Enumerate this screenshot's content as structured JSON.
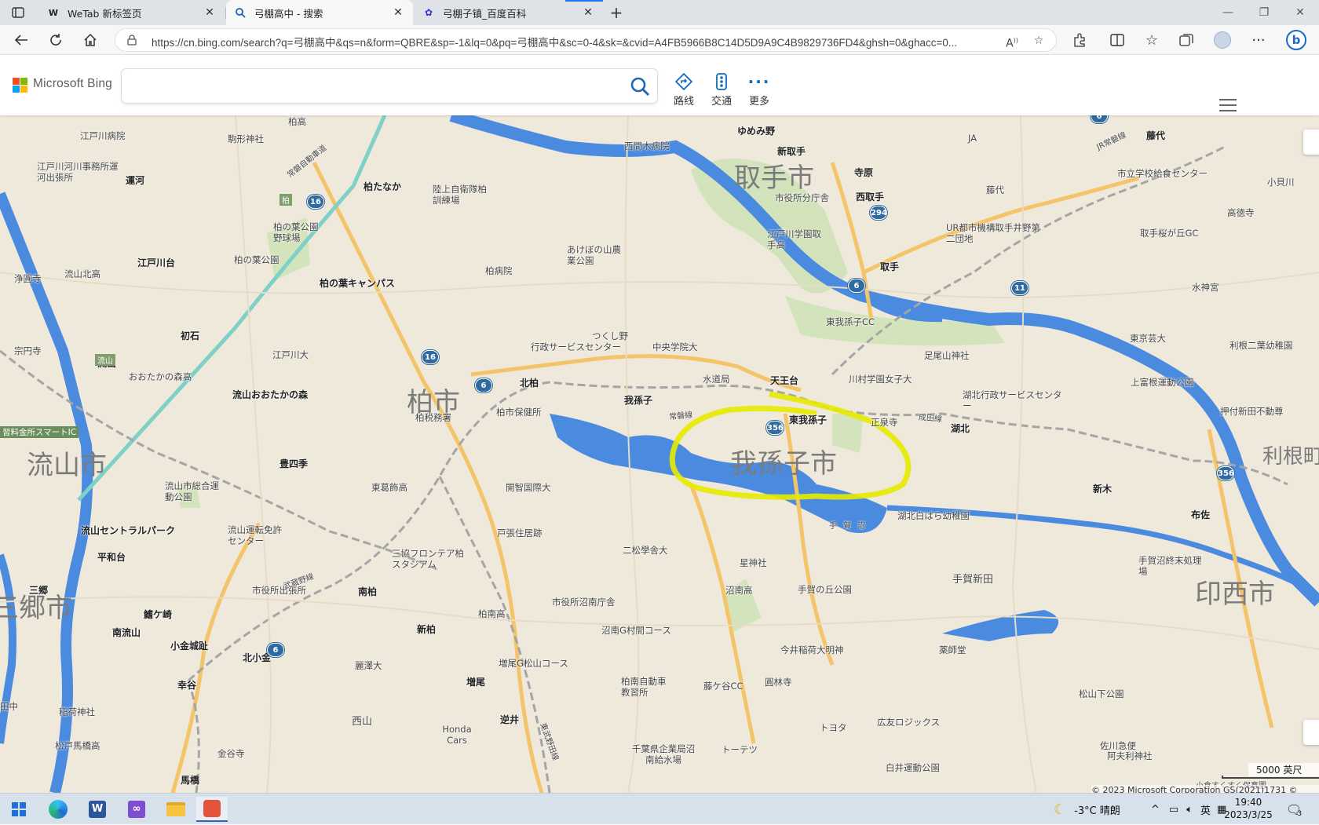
{
  "tabs": [
    {
      "label": "WeTab 新标签页",
      "icon": "wetab-icon",
      "active": false
    },
    {
      "label": "弓棚高中 - 搜索",
      "icon": "bing-search-icon",
      "active": true
    },
    {
      "label": "弓棚子镇_百度百科",
      "icon": "baidu-paw-icon",
      "active": false
    }
  ],
  "address": {
    "url": "https://cn.bing.com/search?q=弓棚高中&qs=n&form=QBRE&sp=-1&lq=0&pq=弓棚高中&sc=0-4&sk=&cvid=A4FB5966B8C14D5D9A9C4B9829736FD4&ghsh=0&ghacc=0..."
  },
  "bing": {
    "brand": "Microsoft Bing",
    "search_value": "",
    "tools": [
      {
        "label": "路线",
        "icon": "directions-icon"
      },
      {
        "label": "交通",
        "icon": "traffic-icon"
      },
      {
        "label": "更多",
        "icon": "more-icon"
      }
    ]
  },
  "map": {
    "cities": [
      "取手市",
      "柏市",
      "我孫子市",
      "流山市",
      "利根町",
      "印西市",
      "三郷市"
    ],
    "labels": [
      "江戸川病院",
      "駒形神社",
      "柏高",
      "西間木病院",
      "ゆめみ野",
      "新取手",
      "寺原",
      "西取手",
      "市役所分庁舎",
      "江戸川学園取手高",
      "取手",
      "JA",
      "藤代",
      "市立学校給食センター",
      "藤代",
      "高徳寺",
      "小貝川",
      "UR都市機構取手井野第二団地",
      "取手桜が丘GC",
      "水神宮",
      "江戸川河川事務所運河出張所",
      "運河",
      "柏たなか",
      "陸上自衛隊柏訓練場",
      "柏の葉公園野球場",
      "柏の葉公園",
      "柏の葉キャンパス",
      "江戸川台",
      "流山北高",
      "浄圓寺",
      "あけぼの山農業公園",
      "柏病院",
      "つくし野",
      "行政サービスセンター",
      "中央学院大",
      "東我孫子CC",
      "足尾山神社",
      "東京芸大",
      "利根二葉幼稚園",
      "上富根運動公園",
      "押付新田不動尊",
      "初石",
      "宗円寺",
      "流山",
      "おおたかの森高",
      "流山おおたかの森",
      "江戸川大",
      "北柏",
      "柏税務署",
      "柏市保健所",
      "我孫子",
      "水道局",
      "天王台",
      "川村学園女子大",
      "東我孫子",
      "正泉寺",
      "湖北",
      "湖北行政サービスセンター",
      "新木",
      "布佐",
      "豊四季",
      "東葛飾高",
      "開智国際大",
      "流山市総合運動公園",
      "流山セントラルパーク",
      "平和台",
      "流山運転免許センター",
      "戸張住居跡",
      "二松學舎大",
      "三協フロンテア柏スタジアム",
      "湖北白ばら幼稚園",
      "手賀沼",
      "星神社",
      "手賀沼終末処理場",
      "手賀新田",
      "市役所出張所",
      "南柏",
      "沼南高",
      "手賀の丘公園",
      "三郷",
      "鰭ケ崎",
      "南流山",
      "小金城趾",
      "北小金",
      "新柏",
      "柏南高",
      "市役所沼南庁舎",
      "沼南G村間コース",
      "今井稲荷大明神",
      "薬師堂",
      "幸谷",
      "麗澤大",
      "増尾",
      "増尾G松山コース",
      "藤ケ谷CC",
      "圓林寺",
      "柏南自動車教習所",
      "松山下公園",
      "逆井",
      "西山",
      "トヨタ",
      "広友ロジックス",
      "阿夫利神社",
      "稲荷神社",
      "松戸馬橋高",
      "金谷寺",
      "Honda Cars",
      "トーテツ",
      "千葉県企業局沼南給水場",
      "白井運動公園",
      "佐川急便",
      "馬橋",
      "常磐線",
      "成田線",
      "東武野田線",
      "常磐自動車道",
      "JR常磐線",
      "柏",
      "流山",
      "武蔵野線",
      "習料金所スマートIC",
      "田中",
      "小倉すくすく保育園"
    ],
    "route_shields": [
      "16",
      "16",
      "6",
      "6",
      "294",
      "6",
      "11",
      "356",
      "356",
      "6"
    ],
    "scale": "5000 英尺",
    "attribution": "© 2023 Microsoft Corporation  GS(2021)1731 © 2023"
  },
  "taskbar": {
    "apps": [
      "windows-start-icon",
      "edge-icon",
      "word-icon",
      "visual-studio-icon",
      "file-explorer-icon",
      "recorder-icon"
    ],
    "weather": "-3°C 晴朗",
    "ime": "英",
    "time": "19:40",
    "date": "2023/3/25",
    "notifications": "3"
  }
}
